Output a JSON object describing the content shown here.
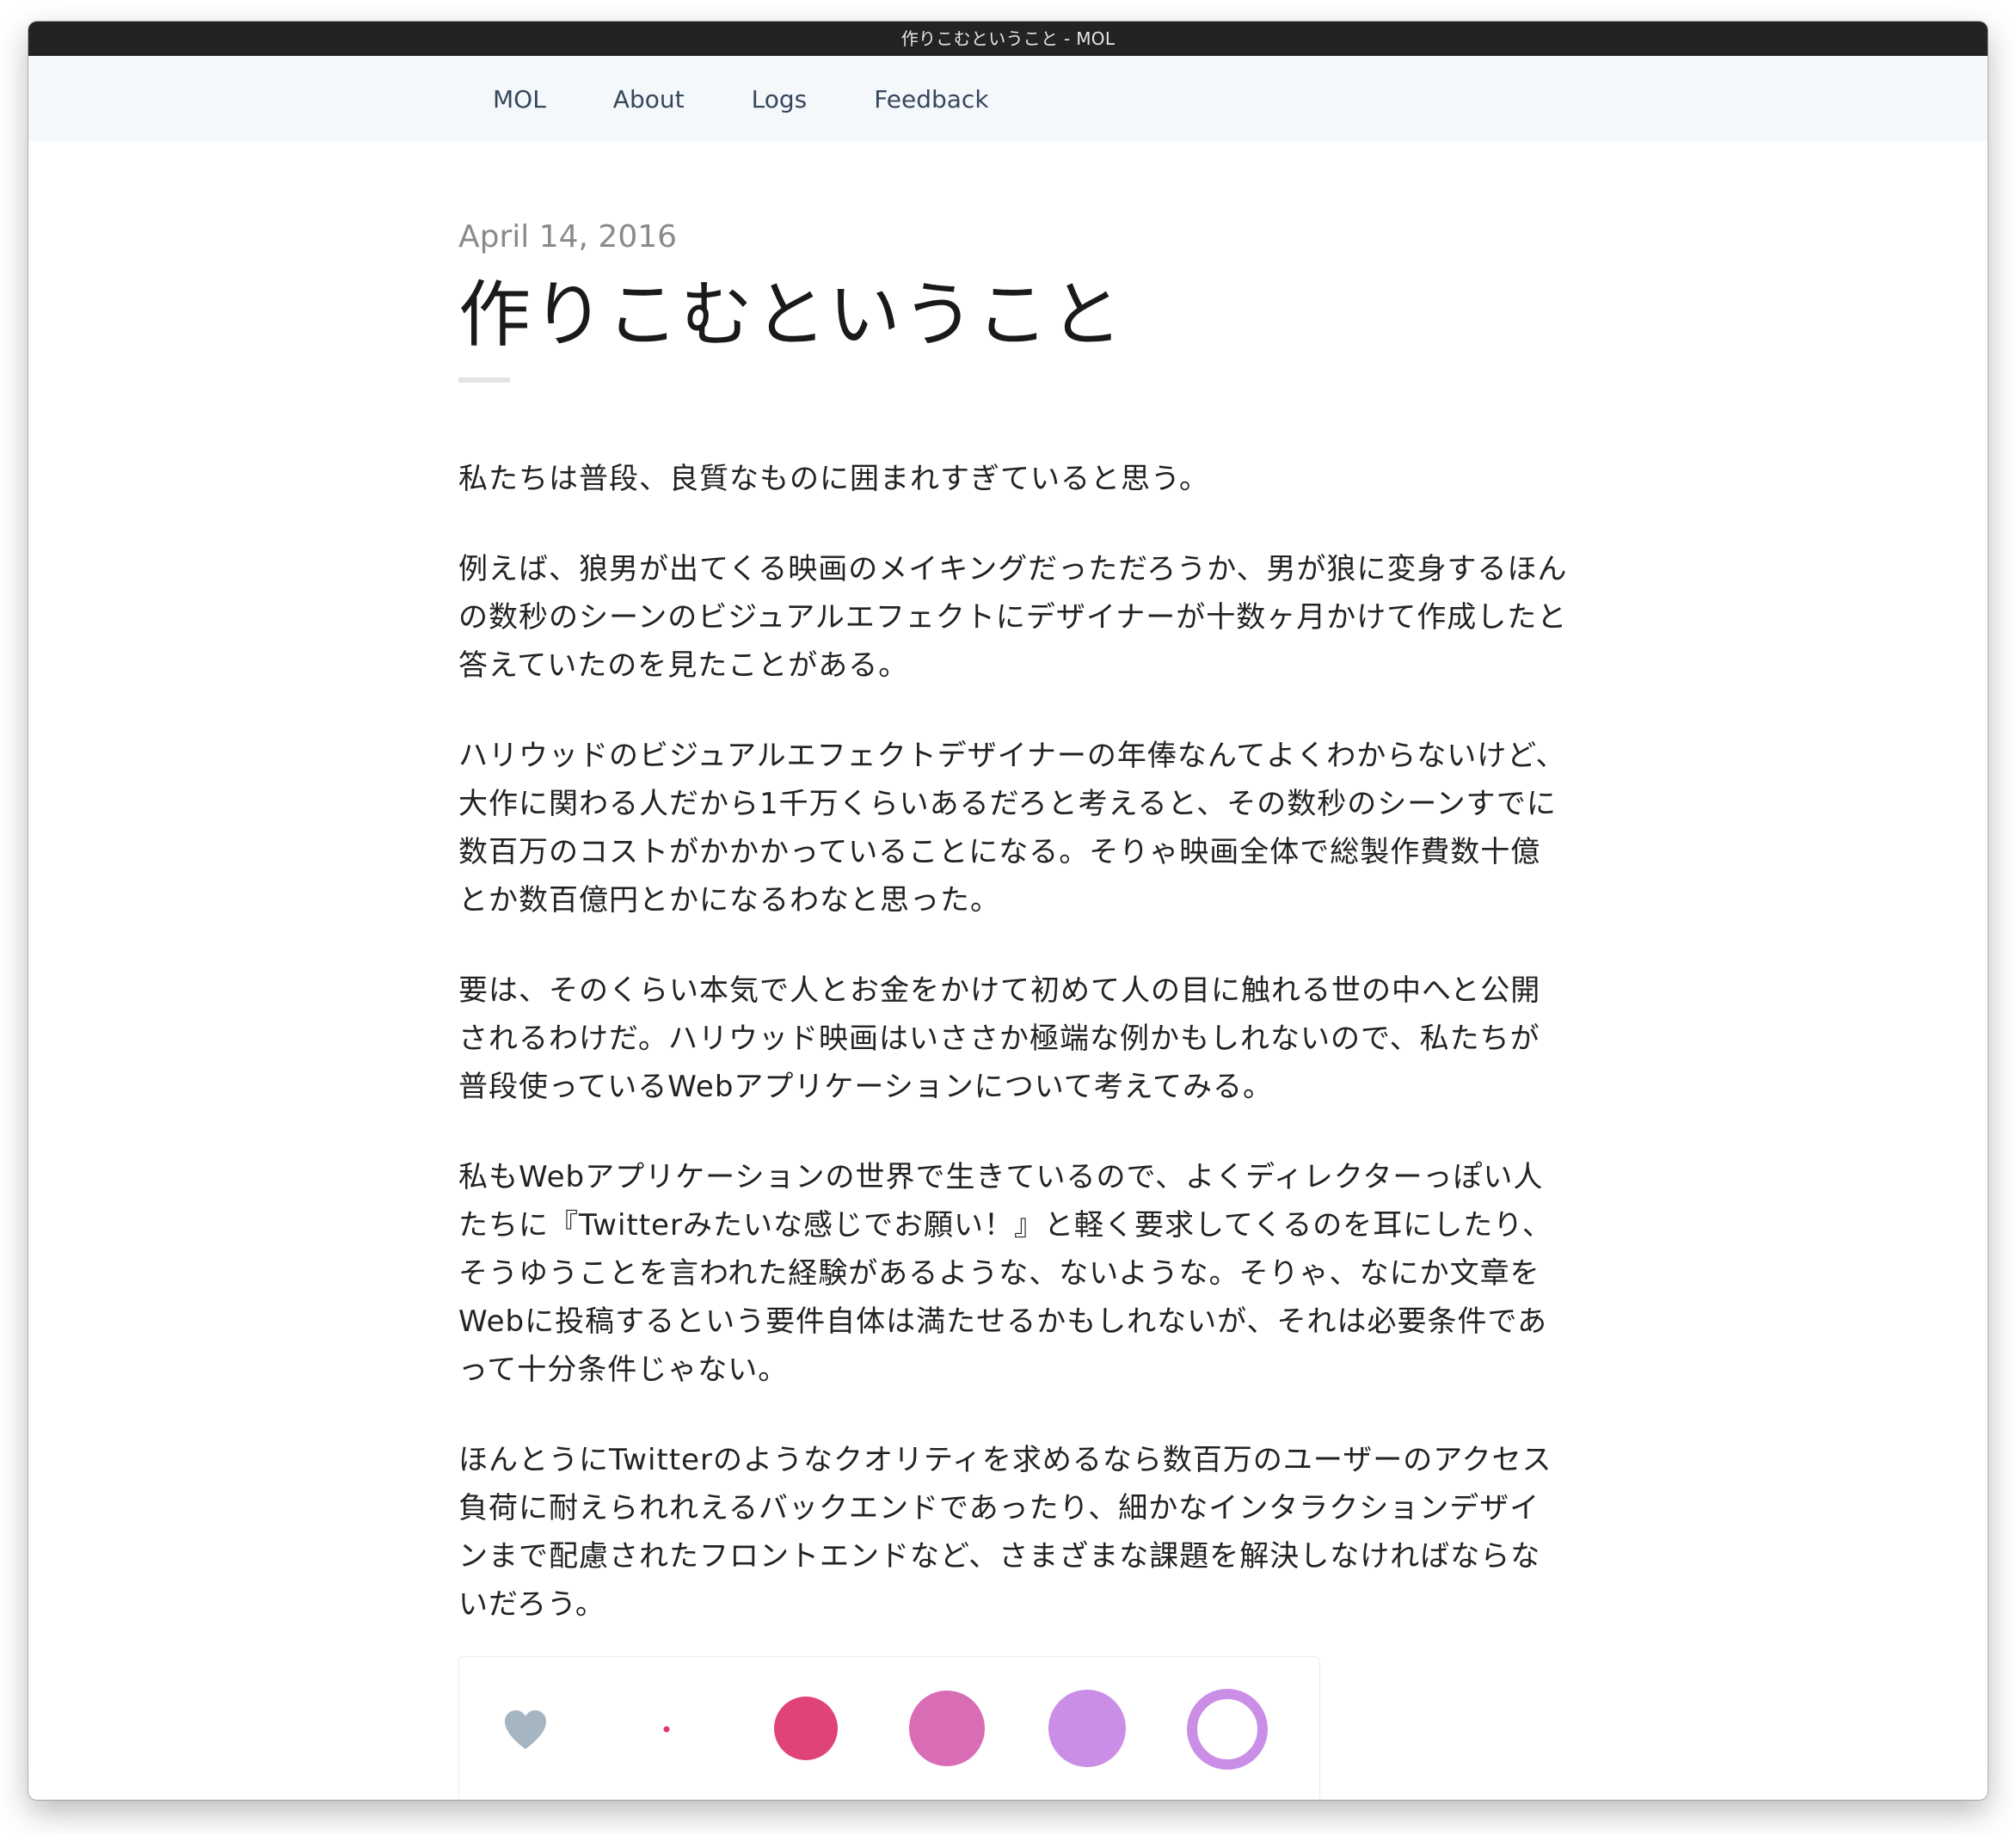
{
  "window": {
    "title": "作りこむということ - MOL"
  },
  "nav": {
    "items": [
      {
        "label": "MOL"
      },
      {
        "label": "About"
      },
      {
        "label": "Logs"
      },
      {
        "label": "Feedback"
      }
    ]
  },
  "post": {
    "date": "April 14, 2016",
    "title": "作りこむということ",
    "paragraphs": [
      "私たちは普段、良質なものに囲まれすぎていると思う。",
      "例えば、狼男が出てくる映画のメイキングだっただろうか、男が狼に変身するほんの数秒のシーンのビジュアルエフェクトにデザイナーが十数ヶ月かけて作成したと答えていたのを見たことがある。",
      "ハリウッドのビジュアルエフェクトデザイナーの年俸なんてよくわからないけど、大作に関わる人だから1千万くらいあるだろと考えると、その数秒のシーンすでに数百万のコストがかかかっていることになる。そりゃ映画全体で総製作費数十億とか数百億円とかになるわなと思った。",
      "要は、そのくらい本気で人とお金をかけて初めて人の目に触れる世の中へと公開されるわけだ。ハリウッド映画はいささか極端な例かもしれないので、私たちが普段使っているWebアプリケーションについて考えてみる。",
      "私もWebアプリケーションの世界で生きているので、よくディレクターっぽい人たちに『Twitterみたいな感じでお願い！』と軽く要求してくるのを耳にしたり、そうゆうことを言われた経験があるような、ないような。そりゃ、なにか文章をWebに投稿するという要件自体は満たせるかもしれないが、それは必要条件であって十分条件じゃない。",
      "ほんとうにTwitterのようなクオリティを求めるなら数百万のユーザーのアクセス負荷に耐えられれえるバックエンドであったり、細かなインタラクションデザインまで配慮されたフロントエンドなど、さまざまな課題を解決しなければならないだろう。"
    ]
  },
  "animation": {
    "frames": [
      {
        "shape": "heart-icon",
        "color": "#a6b5c2"
      },
      {
        "shape": "dot",
        "color": "#e0356e"
      },
      {
        "shape": "filled-circle",
        "color": "#e0427a"
      },
      {
        "shape": "filled-circle",
        "color": "#d86cb5"
      },
      {
        "shape": "filled-circle",
        "color": "#cb8ee6"
      },
      {
        "shape": "ring",
        "color": "#cb8ee6"
      }
    ]
  }
}
